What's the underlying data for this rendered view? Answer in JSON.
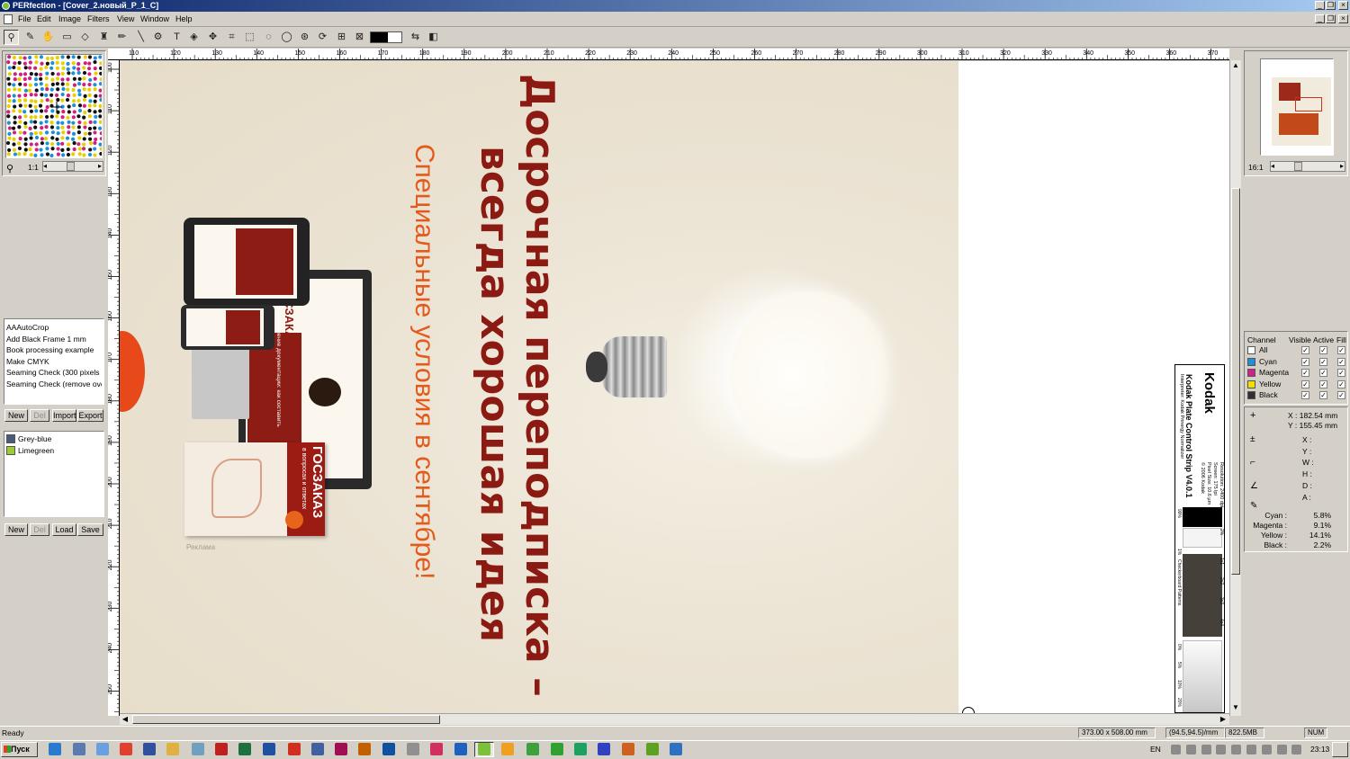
{
  "window": {
    "title": "PERfection - [Cover_2.новый_P_1_C]"
  },
  "menu": [
    "File",
    "Edit",
    "Image",
    "Filters",
    "View",
    "Window",
    "Help"
  ],
  "tools": [
    {
      "name": "zoom-tool-icon",
      "glyph": "⚲"
    },
    {
      "name": "eyedropper-tool-icon",
      "glyph": "✎"
    },
    {
      "name": "hand-tool-icon",
      "glyph": "✋"
    },
    {
      "name": "measure-tool-icon",
      "glyph": "▭"
    },
    {
      "name": "eraser-tool-icon",
      "glyph": "◇"
    },
    {
      "name": "stamp-tool-icon",
      "glyph": "♜"
    },
    {
      "name": "pencil-tool-icon",
      "glyph": "✏"
    },
    {
      "name": "line-tool-icon",
      "glyph": "╲"
    },
    {
      "name": "brush-tool-icon",
      "glyph": "⚙"
    },
    {
      "name": "text-tool-icon",
      "glyph": "T"
    },
    {
      "name": "transform-tool-icon",
      "glyph": "◈"
    },
    {
      "name": "move-tool-icon",
      "glyph": "✥"
    },
    {
      "name": "crop-tool-icon",
      "glyph": "⌗"
    },
    {
      "name": "rect-select-tool-icon",
      "glyph": "⬚"
    },
    {
      "name": "ellipse-select-tool-icon",
      "glyph": "◌"
    },
    {
      "name": "lasso-tool-icon",
      "glyph": "◯"
    },
    {
      "name": "magic-select-tool-icon",
      "glyph": "⊛"
    },
    {
      "name": "rotate-select-tool-icon",
      "glyph": "⟳"
    },
    {
      "name": "frame-select-tool-icon",
      "glyph": "⊞"
    },
    {
      "name": "border-select-tool-icon",
      "glyph": "⊠"
    }
  ],
  "navigator": {
    "zoom": "1:1"
  },
  "preview": {
    "zoom": "16:1"
  },
  "actions": {
    "items": [
      "AAAutoCrop",
      "Add Black Frame 1 mm",
      "Book processing example",
      "Make CMYK",
      "Seaming Check (300 pixels o",
      "Seaming Check (remove ove"
    ],
    "buttons": [
      "New",
      "Del",
      "Import",
      "Export"
    ]
  },
  "colors": {
    "items": [
      {
        "label": "Grey-blue",
        "color": "#4a5a78"
      },
      {
        "label": "Limegreen",
        "color": "#9acd32"
      }
    ],
    "buttons": [
      "New",
      "Del",
      "Load",
      "Save"
    ]
  },
  "ruler_h": [
    "110",
    "120",
    "130",
    "140",
    "150",
    "160",
    "170",
    "180",
    "190",
    "200",
    "210",
    "220",
    "230",
    "240",
    "250",
    "260",
    "270",
    "280",
    "290",
    "300",
    "310",
    "320",
    "330",
    "340",
    "350",
    "360",
    "370"
  ],
  "ruler_v": [
    "100",
    "110",
    "120",
    "130",
    "140",
    "150",
    "160",
    "170",
    "180",
    "190",
    "200",
    "210",
    "220",
    "230",
    "240",
    "250"
  ],
  "document": {
    "headline1": "Досрочная переподписка –",
    "headline2": "всегда хорошая идея",
    "subline": "Специальные условия в сентябре!",
    "ad_label": "Реклама",
    "brand": "ГОСЗАКАЗ",
    "screen_text": "Запрос на разъяснение документации: как составить",
    "book_text": "в вопросах и ответах",
    "strip_brand": "Kodak",
    "strip_title": "Kodak Plate Control Strip V4.0.1",
    "strip_interpreter": "Interpreter: Kodak Prinergy Normalizer",
    "strip_info": [
      "Resolution: 2400 dpi",
      "Screen: 175 lpi",
      "Pixel Size: 10.6 µm",
      "© 2006 Kodak"
    ],
    "strip_labels": [
      "99%",
      "2%",
      "1%",
      "1x1",
      "2x2",
      "3x3",
      "4x4",
      "Checkerboard Patterns",
      "0%",
      "5%",
      "10%",
      "20%"
    ]
  },
  "channels": {
    "header": [
      "Channel",
      "Visible",
      "Active",
      "Fill"
    ],
    "rows": [
      {
        "label": "All",
        "color": "#ffffff"
      },
      {
        "label": "Cyan",
        "color": "#1e90d8"
      },
      {
        "label": "Magenta",
        "color": "#d0208a"
      },
      {
        "label": "Yellow",
        "color": "#f0e000"
      },
      {
        "label": "Black",
        "color": "#303030"
      }
    ]
  },
  "info": {
    "x": "X : 182.54 mm",
    "y": "Y : 155.45 mm",
    "labels": [
      "X :",
      "Y :",
      "W :",
      "H :",
      "D :",
      "A :"
    ],
    "cmyk": [
      {
        "label": "Cyan :",
        "value": "5.8%"
      },
      {
        "label": "Magenta :",
        "value": "9.1%"
      },
      {
        "label": "Yellow :",
        "value": "14.1%"
      },
      {
        "label": "Black :",
        "value": "2.2%"
      }
    ]
  },
  "status": {
    "ready": "Ready",
    "size": "373.00 x 508.00 mm",
    "res": "(94.5,94.5)/mm",
    "mem": "822.5MB",
    "num": "NUM"
  },
  "taskbar": {
    "start": "Пуск",
    "lang": "EN",
    "time": "23:13"
  },
  "taskbar_apps": [
    {
      "name": "outlook-taskbar-icon",
      "color": "#2a7ad0"
    },
    {
      "name": "network-taskbar-icon",
      "color": "#5a7ab0"
    },
    {
      "name": "explorer-taskbar-icon",
      "color": "#6aa0e0"
    },
    {
      "name": "chrome-taskbar-icon",
      "color": "#e04030"
    },
    {
      "name": "save-taskbar-icon",
      "color": "#3050a0"
    },
    {
      "name": "folder-taskbar-icon",
      "color": "#e0b040"
    },
    {
      "name": "files-taskbar-icon",
      "color": "#70a0c0"
    },
    {
      "name": "acrobat-taskbar-icon",
      "color": "#c02020"
    },
    {
      "name": "excel-taskbar-icon",
      "color": "#1e7040"
    },
    {
      "name": "word-taskbar-icon",
      "color": "#2050a0"
    },
    {
      "name": "pdf-taskbar-icon",
      "color": "#d03020"
    },
    {
      "name": "manager-taskbar-icon",
      "color": "#4060a0"
    },
    {
      "name": "indesign-taskbar-icon",
      "color": "#a01050"
    },
    {
      "name": "illustrator-taskbar-icon",
      "color": "#c06000"
    },
    {
      "name": "photoshop-taskbar-icon",
      "color": "#1050a0"
    },
    {
      "name": "cd-taskbar-icon",
      "color": "#909090"
    },
    {
      "name": "media-taskbar-icon",
      "color": "#d03060"
    },
    {
      "name": "app-taskbar-icon",
      "color": "#2060c0"
    },
    {
      "name": "perfection-taskbar-icon",
      "color": "#7cc13a"
    },
    {
      "name": "sun-taskbar-icon",
      "color": "#f0a020"
    },
    {
      "name": "tool1-taskbar-icon",
      "color": "#40a040"
    },
    {
      "name": "tool2-taskbar-icon",
      "color": "#30a030"
    },
    {
      "name": "tool3-taskbar-icon",
      "color": "#20a060"
    },
    {
      "name": "pi-taskbar-icon",
      "color": "#3040c0"
    },
    {
      "name": "img-taskbar-icon",
      "color": "#d06020"
    },
    {
      "name": "puzzle-taskbar-icon",
      "color": "#60a020"
    },
    {
      "name": "window-taskbar-icon",
      "color": "#3070c0"
    }
  ],
  "tray_icons": [
    "display-tray-icon",
    "update-tray-icon",
    "volume-tray-icon",
    "network-tray-icon",
    "shield-tray-icon",
    "sound-tray-icon",
    "flag-tray-icon",
    "usb-tray-icon",
    "battery-tray-icon"
  ]
}
